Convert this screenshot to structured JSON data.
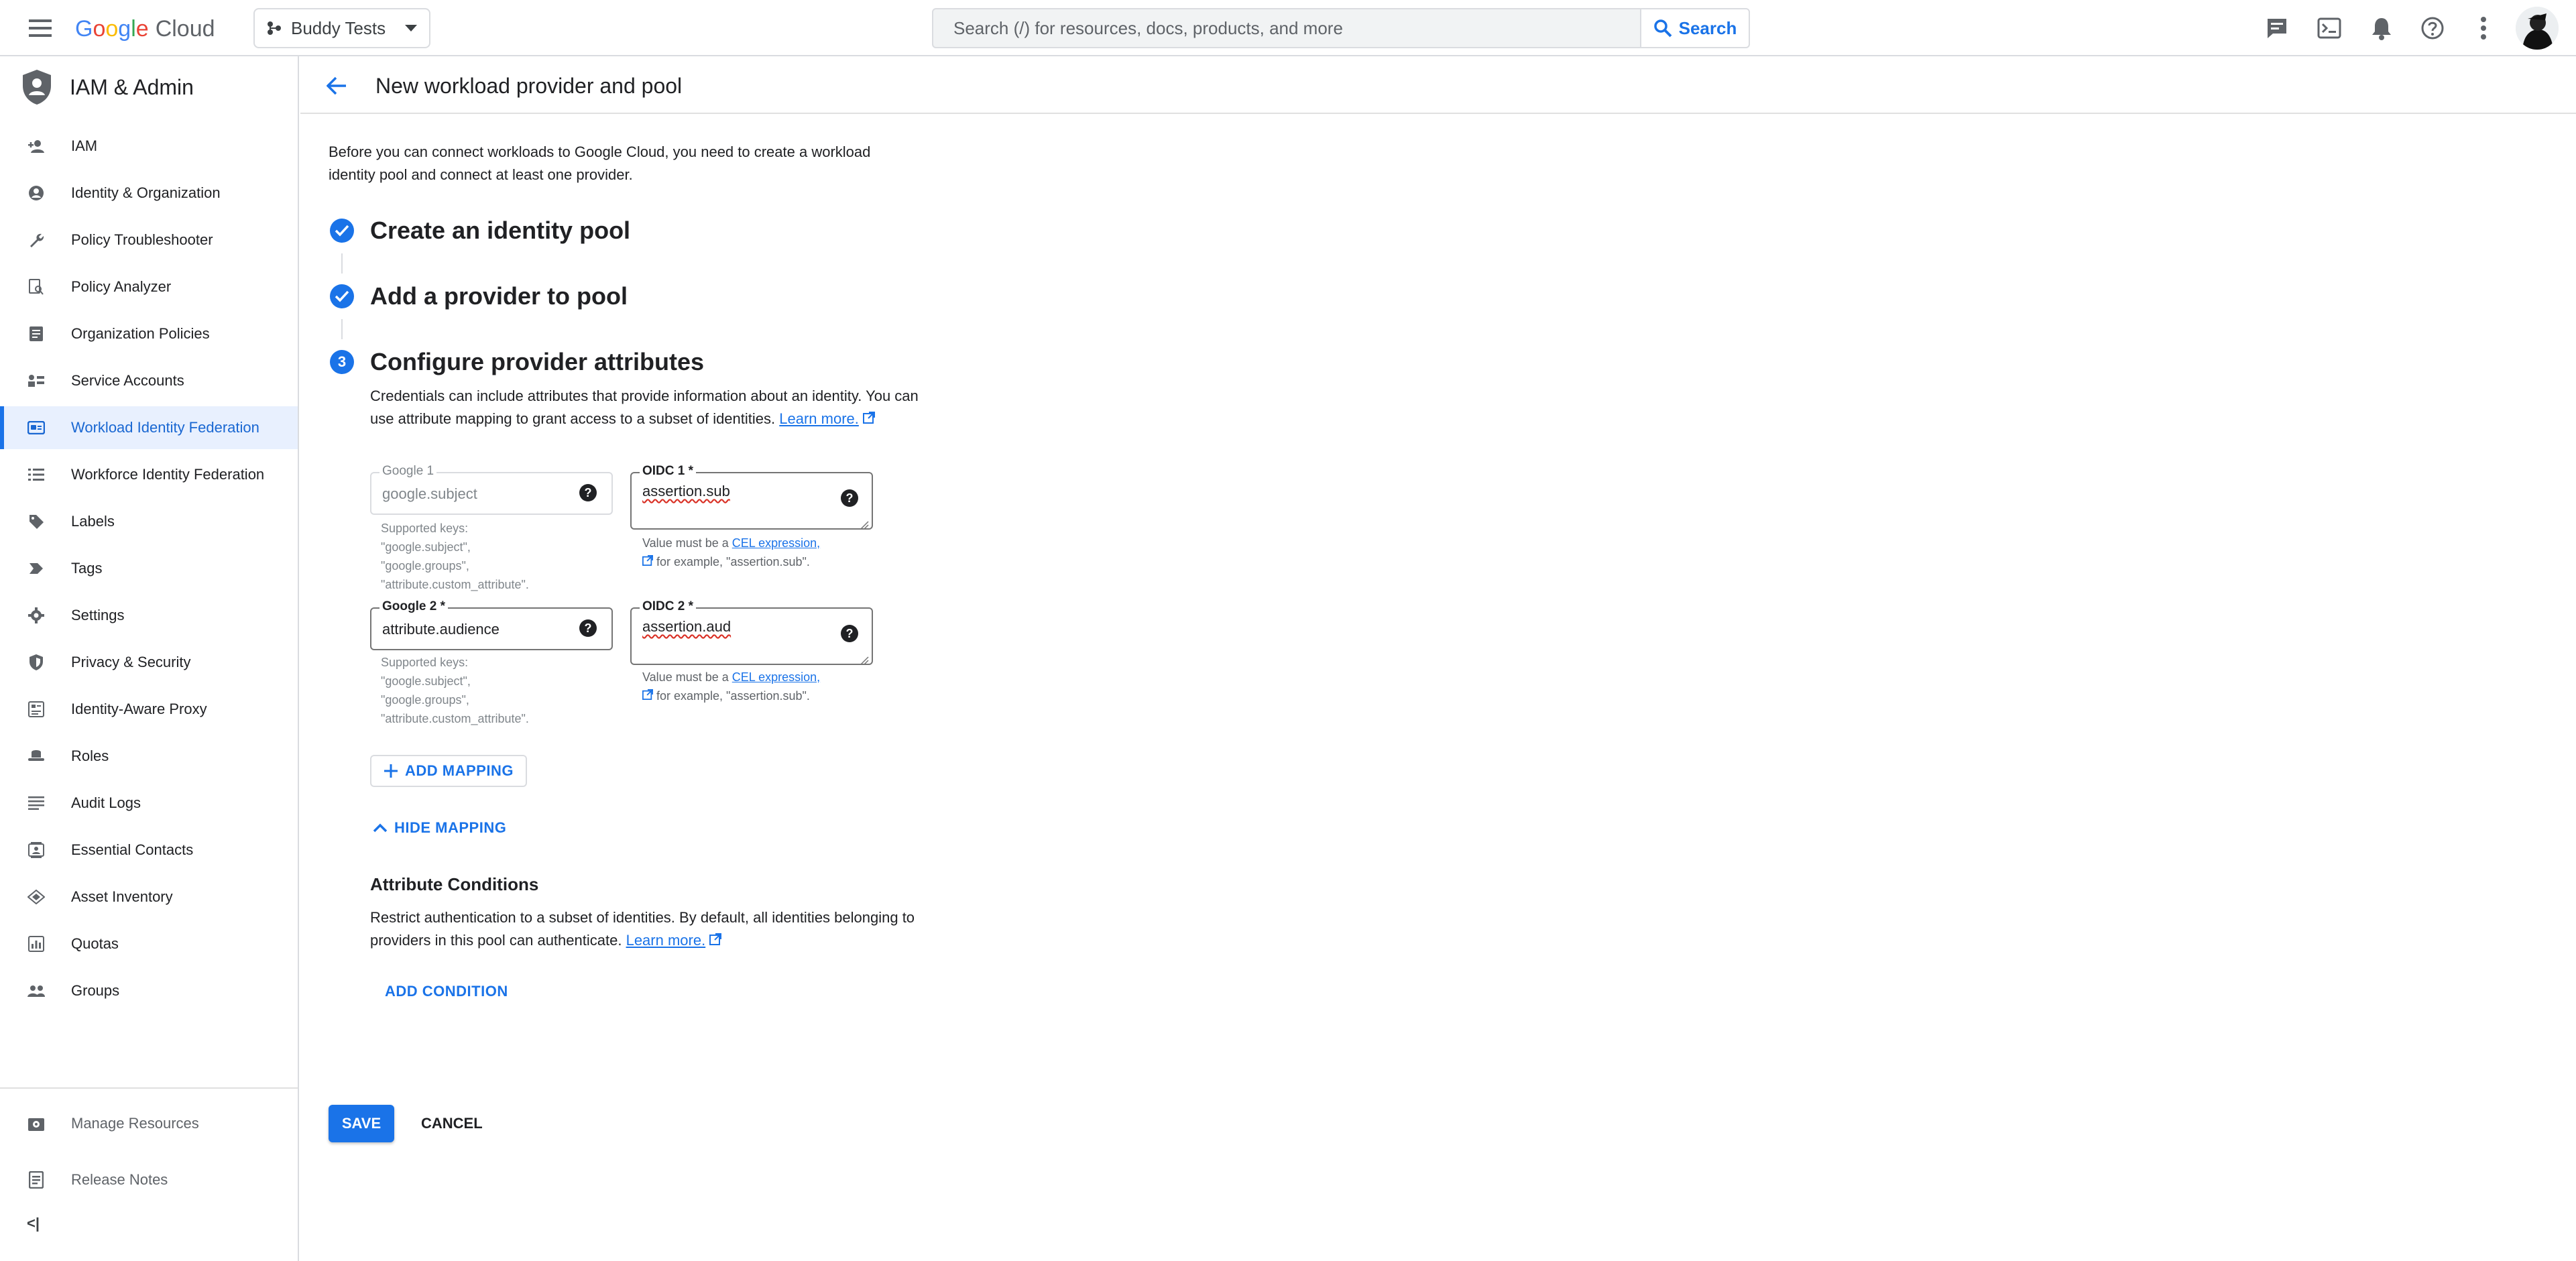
{
  "topbar": {
    "logo_google": [
      "G",
      "o",
      "o",
      "g",
      "l",
      "e"
    ],
    "logo_cloud": "Cloud",
    "project_name": "Buddy Tests",
    "search_placeholder": "Search (/) for resources, docs, products, and more",
    "search_button": "Search",
    "icons": [
      "notes-icon",
      "terminal-icon",
      "notifications-icon",
      "help-icon",
      "more-vert-icon"
    ]
  },
  "sidebar": {
    "title": "IAM & Admin",
    "items": [
      {
        "label": "IAM",
        "icon": "person-add-icon"
      },
      {
        "label": "Identity & Organization",
        "icon": "account-circle-icon"
      },
      {
        "label": "Policy Troubleshooter",
        "icon": "wrench-icon"
      },
      {
        "label": "Policy Analyzer",
        "icon": "policy-analyzer-icon"
      },
      {
        "label": "Organization Policies",
        "icon": "document-icon"
      },
      {
        "label": "Service Accounts",
        "icon": "service-account-icon"
      },
      {
        "label": "Workload Identity Federation",
        "icon": "id-card-icon",
        "active": true
      },
      {
        "label": "Workforce Identity Federation",
        "icon": "list-icon"
      },
      {
        "label": "Labels",
        "icon": "tag-icon"
      },
      {
        "label": "Tags",
        "icon": "label-arrow-icon"
      },
      {
        "label": "Settings",
        "icon": "gear-icon"
      },
      {
        "label": "Privacy & Security",
        "icon": "shield-icon"
      },
      {
        "label": "Identity-Aware Proxy",
        "icon": "proxy-icon"
      },
      {
        "label": "Roles",
        "icon": "hat-icon"
      },
      {
        "label": "Audit Logs",
        "icon": "lines-icon"
      },
      {
        "label": "Essential Contacts",
        "icon": "contacts-icon"
      },
      {
        "label": "Asset Inventory",
        "icon": "diamond-icon"
      },
      {
        "label": "Quotas",
        "icon": "quota-icon"
      },
      {
        "label": "Groups",
        "icon": "group-icon"
      }
    ],
    "footer_items": [
      {
        "label": "Manage Resources",
        "icon": "settings-box-icon"
      },
      {
        "label": "Release Notes",
        "icon": "notes-doc-icon"
      }
    ],
    "collapse_label": "<|"
  },
  "page": {
    "title": "New workload provider and pool",
    "intro": "Before you can connect workloads to Google Cloud, you need to create a workload identity pool and connect at least one provider.",
    "steps": [
      {
        "title": "Create an identity pool",
        "status": "done"
      },
      {
        "title": "Add a provider to pool",
        "status": "done"
      },
      {
        "title": "Configure provider attributes",
        "status": "current",
        "number": "3"
      }
    ],
    "step3_desc": "Credentials can include attributes that provide information about an identity. You can use attribute mapping to grant access to a subset of identities.",
    "learn_more": "Learn more.",
    "mappings": [
      {
        "google_label": "Google 1",
        "google_value": "google.subject",
        "google_disabled": true,
        "oidc_label": "OIDC 1 *",
        "oidc_value": "assertion.sub"
      },
      {
        "google_label": "Google 2 *",
        "google_value": "attribute.audience",
        "google_disabled": false,
        "oidc_label": "OIDC 2 *",
        "oidc_value": "assertion.aud"
      }
    ],
    "supported_keys": [
      "Supported keys:",
      "\"google.subject\",",
      "\"google.groups\",",
      "\"attribute.custom_attribute\"."
    ],
    "hint_prefix": "Value must be a",
    "hint_link": "CEL expression,",
    "hint_example": "for example, \"assertion.sub\".",
    "add_mapping": "ADD MAPPING",
    "hide_mapping": "HIDE MAPPING",
    "attr_cond_title": "Attribute Conditions",
    "attr_cond_desc": "Restrict authentication to a subset of identities. By default, all identities belonging to providers in this pool can authenticate.",
    "add_condition": "ADD CONDITION",
    "save": "SAVE",
    "cancel": "CANCEL"
  },
  "colors": {
    "accent": "#1a73e8",
    "active_bg": "#e8f0fe",
    "text": "#202124",
    "muted": "#5f6368"
  }
}
